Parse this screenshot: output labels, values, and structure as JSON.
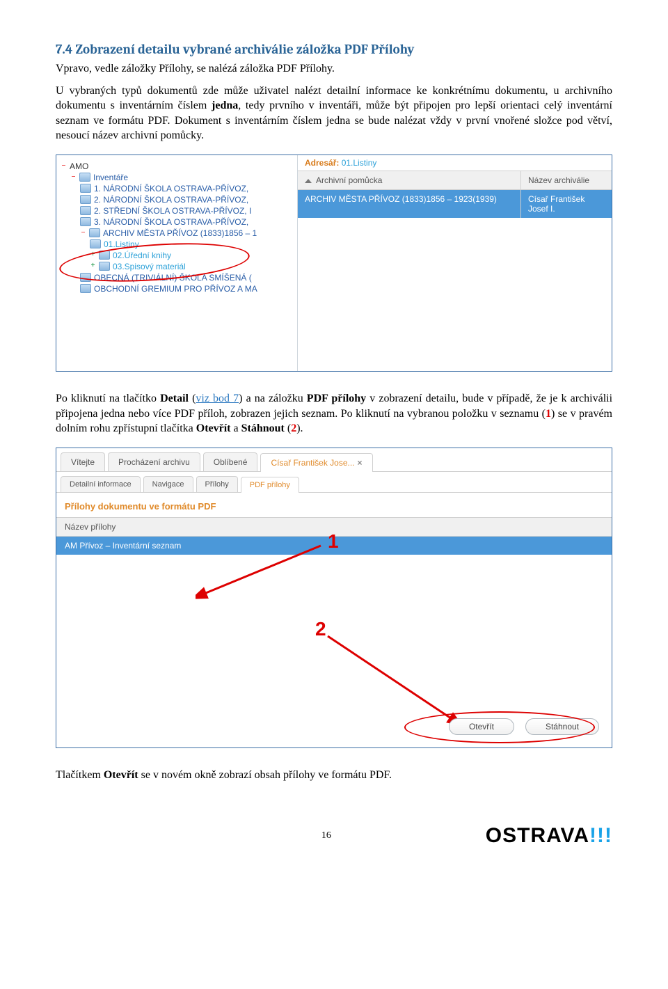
{
  "heading": "7.4  Zobrazení detailu vybrané archiválie záložka PDF Přílohy",
  "para1": "Vpravo, vedle záložky Přílohy, se nalézá záložka PDF Přílohy.",
  "para2a": "U vybraných typů dokumentů zde může uživatel nalézt detailní informace ke konkrétnímu dokumentu, u archivního dokumentu s inventárním číslem ",
  "para2b": "jedna",
  "para2c": ", tedy prvního v inventáři, může být připojen pro lepší orientaci celý inventární seznam ve formátu PDF. Dokument s inventárním číslem jedna se bude nalézat vždy v první vnořené složce pod větví, nesoucí název archivní pomůcky.",
  "shot1": {
    "addr_label": "Adresář:",
    "addr_value": "01.Listiny",
    "col_finding_aid": "Archivní pomůcka",
    "col_name": "Název archiválie",
    "row_finding_aid": "ARCHIV MĚSTA PŘÍVOZ (1833)1856 – 1923(1939)",
    "row_name": "Císař František Josef I.",
    "tree": {
      "root": "AMO",
      "n1": "Inventáře",
      "n2": "1. NÁRODNÍ ŠKOLA OSTRAVA-PŘÍVOZ,",
      "n3": "2. NÁRODNÍ ŠKOLA OSTRAVA-PŘÍVOZ,",
      "n4": "2. STŘEDNÍ ŠKOLA OSTRAVA-PŘÍVOZ, I",
      "n5": "3. NÁRODNÍ ŠKOLA OSTRAVA-PŘÍVOZ,",
      "n6": "ARCHIV MĚSTA PŘÍVOZ (1833)1856 – 1",
      "n7": "01.Listiny",
      "n8": "02.Úřední knihy",
      "n9": "03.Spisový materiál",
      "n10": "OBECNÁ (TRIVIÁLNÍ) ŠKOLA SMÍŠENÁ (",
      "n11": "OBCHODNÍ GREMIUM PRO PŘÍVOZ A MA"
    }
  },
  "para3a": "Po kliknutí na tlačítko ",
  "para3_detail": "Detail",
  "para3b": " (",
  "para3_link": "viz bod 7",
  "para3c": ") a na záložku ",
  "para3_pdf": "PDF přílohy",
  "para3d": " v zobrazení detailu, bude v případě, že je k archiválii připojena jedna nebo více PDF příloh, zobrazen jejich seznam. Po kliknutí na vybranou položku v seznamu (",
  "para3_one": "1",
  "para3e": ") se v pravém dolním rohu zpřístupní tlačítka ",
  "para3_open": "Otevřít",
  "para3f": " a ",
  "para3_dl": "Stáhnout",
  "para3g": " (",
  "para3_two": "2",
  "para3h": ").",
  "shot2": {
    "tabs1": {
      "t1": "Vítejte",
      "t2": "Procházení archivu",
      "t3": "Oblíbené",
      "t4": "Císař František Jose..."
    },
    "tabs2": {
      "t1": "Detailní informace",
      "t2": "Navigace",
      "t3": "Přílohy",
      "t4": "PDF přílohy"
    },
    "section": "Přílohy dokumentu ve formátu PDF",
    "list_head": "Název přílohy",
    "list_row": "AM Přívoz – Inventární seznam",
    "btn_open": "Otevřít",
    "btn_dl": "Stáhnout",
    "anno1": "1",
    "anno2": "2"
  },
  "para4a": "Tlačítkem ",
  "para4b": "Otevřít",
  "para4c": " se v novém okně zobrazí obsah přílohy ve formátu PDF.",
  "pagenum": "16",
  "brand_text": "OSTRAVA",
  "brand_excl": "!!!"
}
